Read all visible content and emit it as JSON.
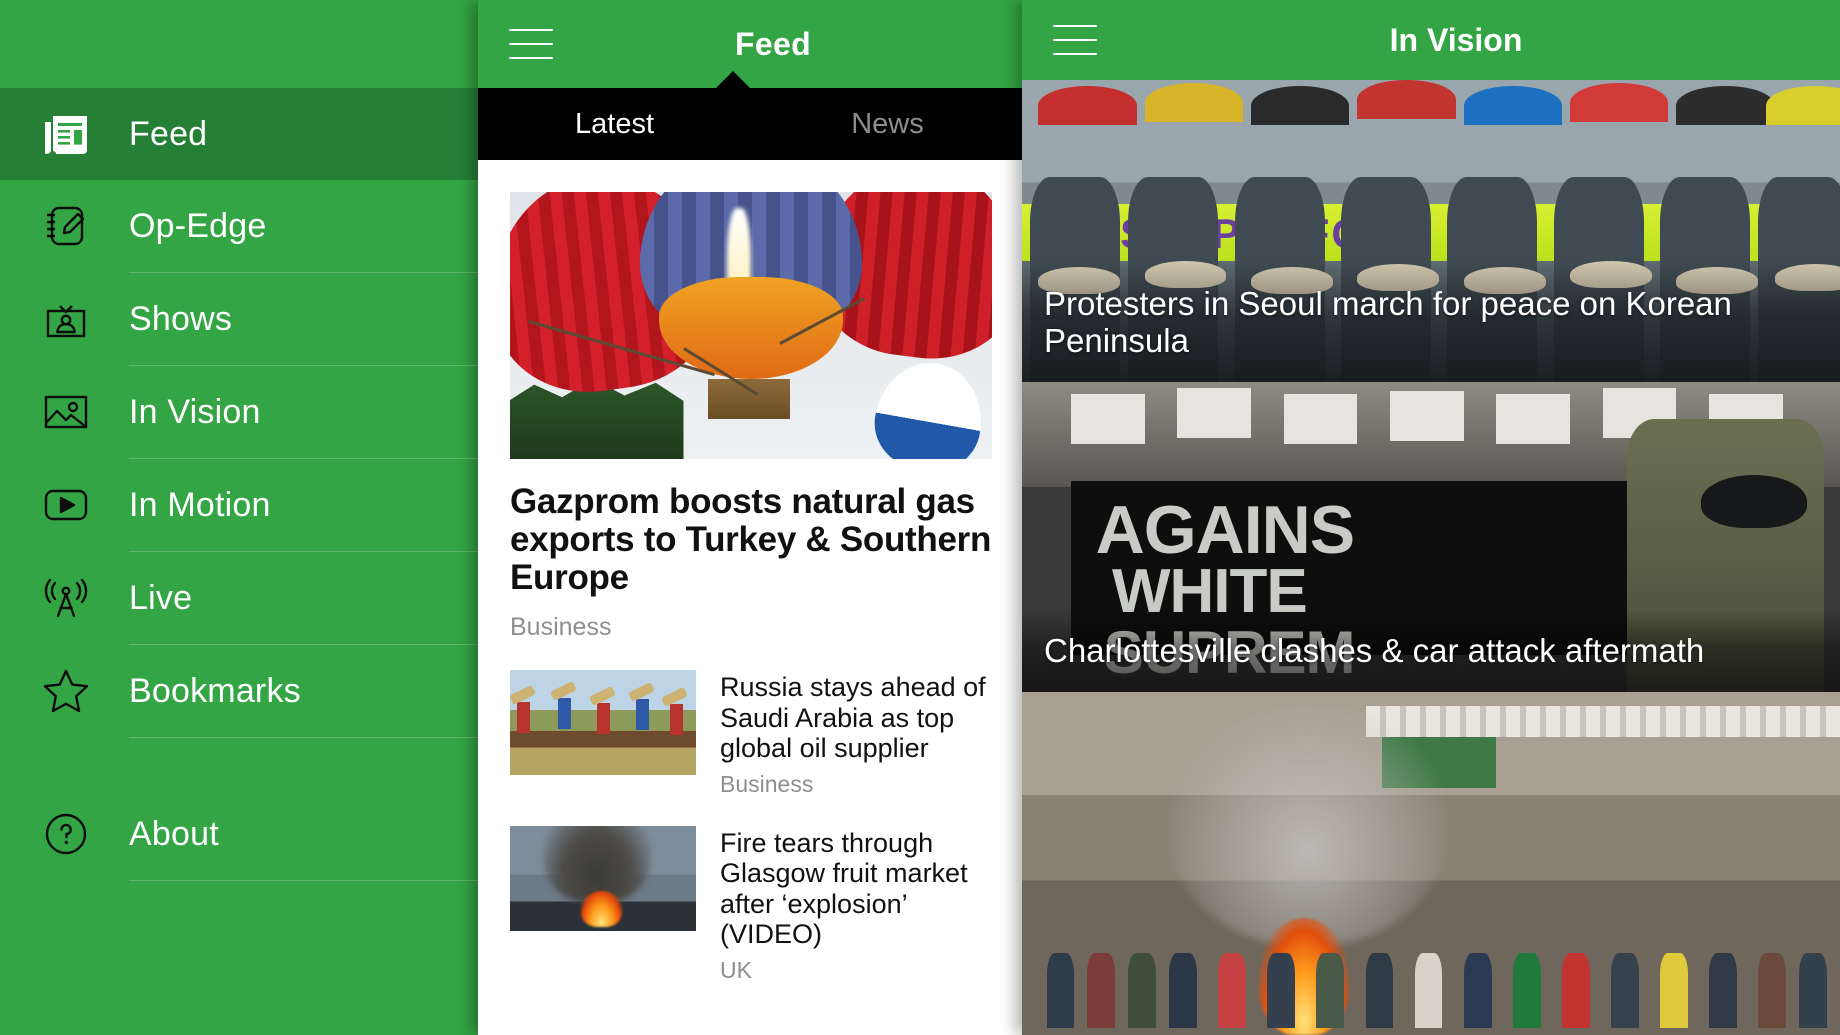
{
  "theme": {
    "brand_green": "#33a544",
    "brand_green_active": "#258036",
    "tabbar_black": "#000000",
    "muted_gray": "#8e8e8e",
    "inactive_tab_gray": "#8d8d8d"
  },
  "drawer": {
    "items": [
      {
        "label": "Feed",
        "icon": "newspaper-icon",
        "active": true
      },
      {
        "label": "Op-Edge",
        "icon": "notepad-pencil-icon",
        "active": false
      },
      {
        "label": "Shows",
        "icon": "tv-person-icon",
        "active": false
      },
      {
        "label": "In Vision",
        "icon": "photo-icon",
        "active": false
      },
      {
        "label": "In Motion",
        "icon": "video-play-icon",
        "active": false
      },
      {
        "label": "Live",
        "icon": "broadcast-tower-icon",
        "active": false
      },
      {
        "label": "Bookmarks",
        "icon": "star-icon",
        "active": false
      },
      {
        "label": "About",
        "icon": "question-circle-icon",
        "active": false
      }
    ]
  },
  "center": {
    "menu_icon": "hamburger-menu-icon",
    "title": "Feed",
    "tabs": [
      {
        "label": "Latest",
        "active": true
      },
      {
        "label": "News",
        "active": false
      }
    ],
    "hero": {
      "image": "hot-air-balloon-photo",
      "title": "Gazprom boosts natural gas exports to Turkey & Southern Europe",
      "category": "Business"
    },
    "articles": [
      {
        "image": "oil-derricks-photo",
        "title": "Russia stays ahead of Saudi Arabia as top global oil supplier",
        "category": "Business"
      },
      {
        "image": "fire-smoke-photo",
        "title": "Fire tears through Glasgow fruit market after ‘explosion’ (VIDEO)",
        "category": "UK"
      }
    ]
  },
  "right": {
    "menu_icon": "hamburger-menu-icon",
    "title": "In Vision",
    "cards": [
      {
        "image": "seoul-protest-photo",
        "caption": "Protesters in Seoul march for peace on Korean Peninsula"
      },
      {
        "image": "charlottesville-photo",
        "caption": "Charlottesville clashes & car attack aftermath"
      },
      {
        "image": "street-protest-fire-photo",
        "caption": ""
      }
    ]
  }
}
